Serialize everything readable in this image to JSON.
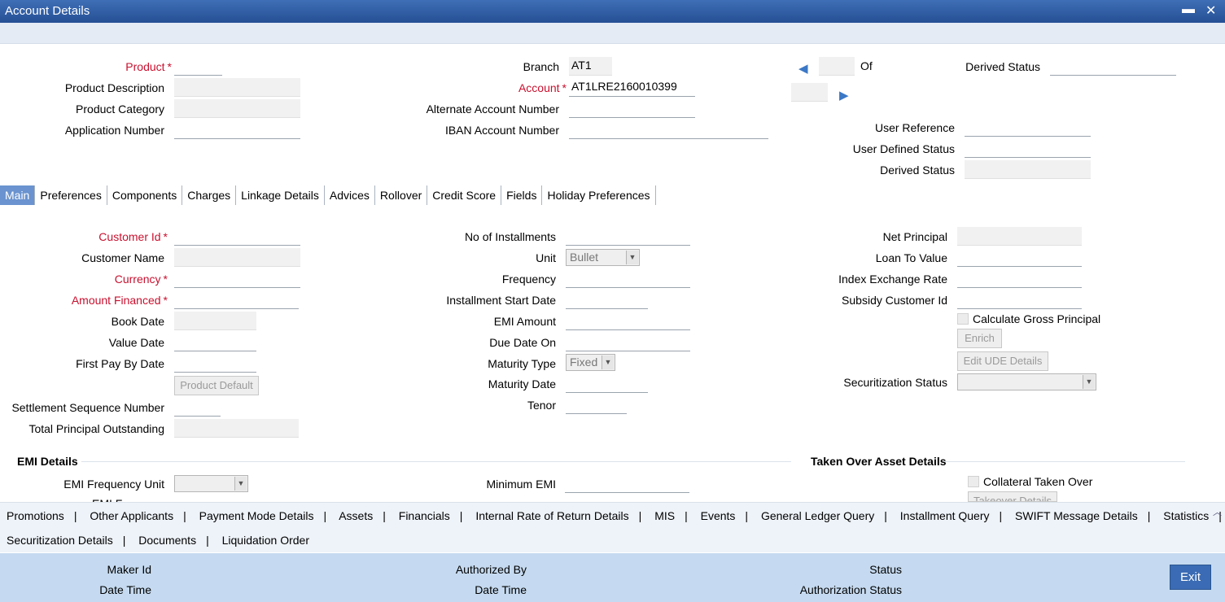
{
  "window": {
    "title": "Account Details",
    "minimize": "▬",
    "close": "✕"
  },
  "header": {
    "product_label": "Product",
    "product_description_label": "Product Description",
    "product_category_label": "Product Category",
    "application_number_label": "Application Number",
    "branch_label": "Branch",
    "branch_value": "AT1",
    "account_label": "Account",
    "account_value": "AT1LRE2160010399",
    "alternate_account_label": "Alternate Account Number",
    "iban_label": "IBAN Account Number",
    "of_label": "Of",
    "derived_status_label": "Derived Status",
    "user_reference_label": "User Reference",
    "user_defined_status_label": "User Defined Status",
    "derived_status2_label": "Derived Status"
  },
  "tabs": [
    "Main",
    "Preferences",
    "Components",
    "Charges",
    "Linkage Details",
    "Advices",
    "Rollover",
    "Credit Score",
    "Fields",
    "Holiday Preferences"
  ],
  "main": {
    "customer_id_label": "Customer Id",
    "customer_name_label": "Customer Name",
    "currency_label": "Currency",
    "amount_financed_label": "Amount Financed",
    "book_date_label": "Book Date",
    "value_date_label": "Value Date",
    "first_pay_by_date_label": "First Pay By Date",
    "product_default_button": "Product Default",
    "settlement_sequence_label": "Settlement Sequence Number",
    "total_principal_label": "Total Principal Outstanding",
    "no_of_installments_label": "No of Installments",
    "unit_label": "Unit",
    "unit_value": "Bullet",
    "frequency_label": "Frequency",
    "installment_start_date_label": "Installment Start Date",
    "emi_amount_label": "EMI Amount",
    "due_date_on_label": "Due Date On",
    "maturity_type_label": "Maturity Type",
    "maturity_type_value": "Fixed",
    "maturity_date_label": "Maturity Date",
    "tenor_label": "Tenor",
    "net_principal_label": "Net Principal",
    "loan_to_value_label": "Loan To Value",
    "index_exchange_rate_label": "Index Exchange Rate",
    "subsidy_customer_id_label": "Subsidy Customer Id",
    "calculate_gross_principal_label": "Calculate Gross Principal",
    "enrich_button": "Enrich",
    "edit_ude_button": "Edit UDE Details",
    "securitization_status_label": "Securitization Status",
    "emi_details_heading": "EMI Details",
    "emi_frequency_unit_label": "EMI Frequency Unit",
    "emi_frequency_partial": "EMI F",
    "minimum_emi_label": "Minimum EMI",
    "taken_over_heading": "Taken Over Asset Details",
    "collateral_taken_over_label": "Collateral Taken Over",
    "takeover_details_button": "Takeover Details"
  },
  "links_row1": [
    "Promotions",
    "Other Applicants",
    "Payment Mode Details",
    "Assets",
    "Financials",
    "Internal Rate of Return Details",
    "MIS",
    "Events",
    "General Ledger Query",
    "Installment Query",
    "SWIFT Message Details",
    "Statistics"
  ],
  "links_row2": [
    "Securitization Details",
    "Documents",
    "Liquidation Order"
  ],
  "footer": {
    "maker_id_label": "Maker Id",
    "date_time_label": "Date Time",
    "authorized_by_label": "Authorized By",
    "date_time2_label": "Date Time",
    "status_label": "Status",
    "authorization_status_label": "Authorization Status",
    "exit_button": "Exit"
  }
}
